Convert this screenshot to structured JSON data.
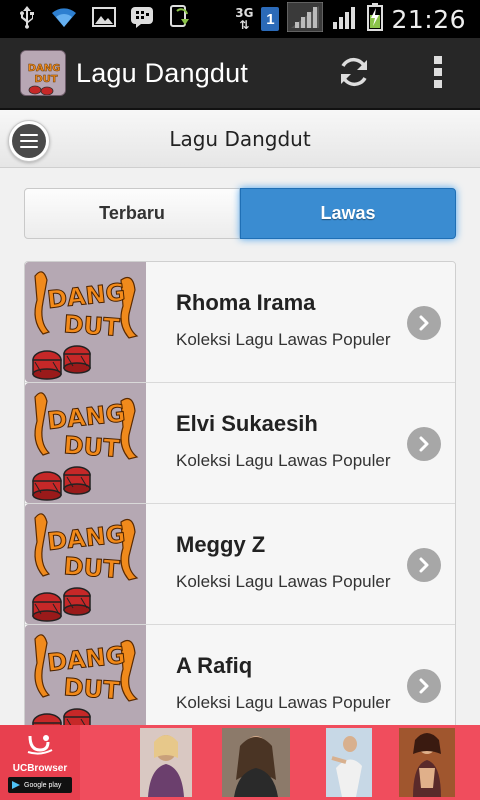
{
  "status_bar": {
    "network_label": "3G",
    "sim_slot": "1",
    "time": "21:26"
  },
  "app_bar": {
    "title": "Lagu Dangdut",
    "logo_text": "DANG DUT"
  },
  "sub_header": {
    "title": "Lagu Dangdut"
  },
  "tabs": [
    {
      "label": "Terbaru",
      "selected": false
    },
    {
      "label": "Lawas",
      "selected": true
    }
  ],
  "list": {
    "items": [
      {
        "title": "Rhoma Irama",
        "subtitle": "Koleksi Lagu Lawas Populer"
      },
      {
        "title": "Elvi Sukaesih",
        "subtitle": "Koleksi Lagu Lawas Populer"
      },
      {
        "title": "Meggy Z",
        "subtitle": "Koleksi Lagu Lawas Populer"
      },
      {
        "title": "A Rafiq",
        "subtitle": "Koleksi Lagu Lawas Populer"
      }
    ]
  },
  "ad_banner": {
    "brand": "UCBrowser",
    "store_badge": "Google play"
  },
  "colors": {
    "accent": "#3a8cd1",
    "action_bar": "#272727",
    "ad_background": "#f04d5d"
  }
}
